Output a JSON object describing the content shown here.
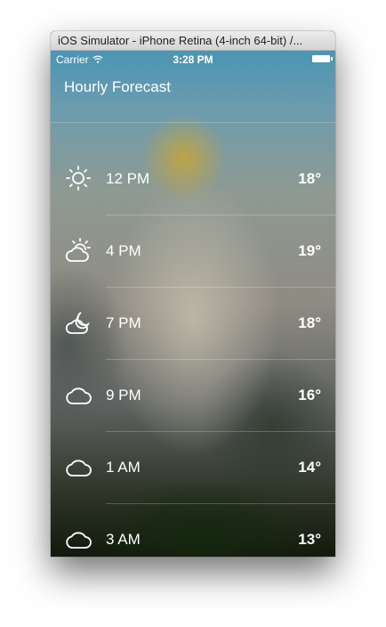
{
  "window": {
    "title": "iOS Simulator - iPhone Retina (4-inch 64-bit) /..."
  },
  "statusbar": {
    "carrier": "Carrier",
    "time": "3:28 PM"
  },
  "header": {
    "title": "Hourly Forecast"
  },
  "forecast": [
    {
      "hour": "12 PM",
      "temp": "18°",
      "icon": "sun-icon"
    },
    {
      "hour": "4 PM",
      "temp": "19°",
      "icon": "partly-sunny-icon"
    },
    {
      "hour": "7 PM",
      "temp": "18°",
      "icon": "cloud-moon-icon"
    },
    {
      "hour": "9 PM",
      "temp": "16°",
      "icon": "cloud-icon"
    },
    {
      "hour": "1 AM",
      "temp": "14°",
      "icon": "cloud-icon"
    },
    {
      "hour": "3 AM",
      "temp": "13°",
      "icon": "cloud-icon"
    }
  ]
}
